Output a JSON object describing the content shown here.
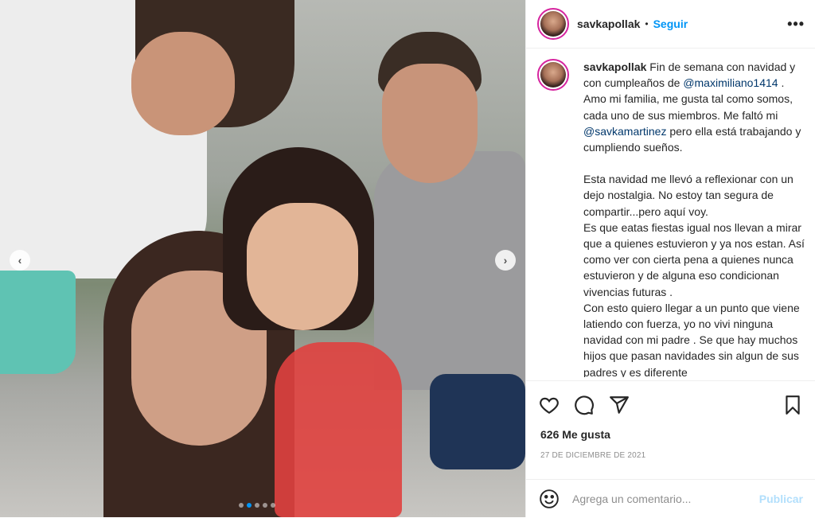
{
  "post": {
    "username": "savkapollak",
    "separator": "•",
    "follow_label": "Seguir",
    "more_label": "•••"
  },
  "photo": {
    "prev_label": "‹",
    "next_label": "›",
    "carousel_total": 5,
    "carousel_active": 1
  },
  "caption": {
    "user": "savkapollak",
    "line1_text": "Fin de semana con navidad y con cumpleaños de",
    "line1_mention": "@maximiliano1414",
    "line2_text": ". Amo mi familia, me gusta tal como somos, cada uno de sus miembros. Me faltó mi",
    "line2_mention": "@savkamartinez",
    "line2_end": "pero ella está trabajando y cumpliendo sueños.",
    "p2": "Esta navidad me llevó a reflexionar con un dejo nostalgia. No estoy tan segura de compartir...pero aquí voy.",
    "p3": "Es que eatas fiestas igual nos llevan a mirar que a quienes estuvieron y ya nos estan. Así como ver con cierta pena a quienes nunca estuvieron y de alguna eso condicionan vivencias futuras .",
    "p4": "Con esto quiero llegar a un punto que viene latiendo con fuerza, yo no vivi ninguna navidad con mi padre . Se que hay muchos hijos que pasan navidades sin algun de sus padres y es diferente"
  },
  "stats": {
    "likes": "626 Me gusta",
    "date": "27 DE DICIEMBRE DE 2021"
  },
  "comment": {
    "placeholder": "Agrega un comentario...",
    "publish_label": "Publicar"
  },
  "colors": {
    "accent": "#0095f6",
    "mention": "#00376b",
    "publish_disabled": "#b2dffc"
  },
  "icons": [
    "heart-icon",
    "comment-icon",
    "share-icon",
    "bookmark-icon",
    "emoji-icon"
  ]
}
